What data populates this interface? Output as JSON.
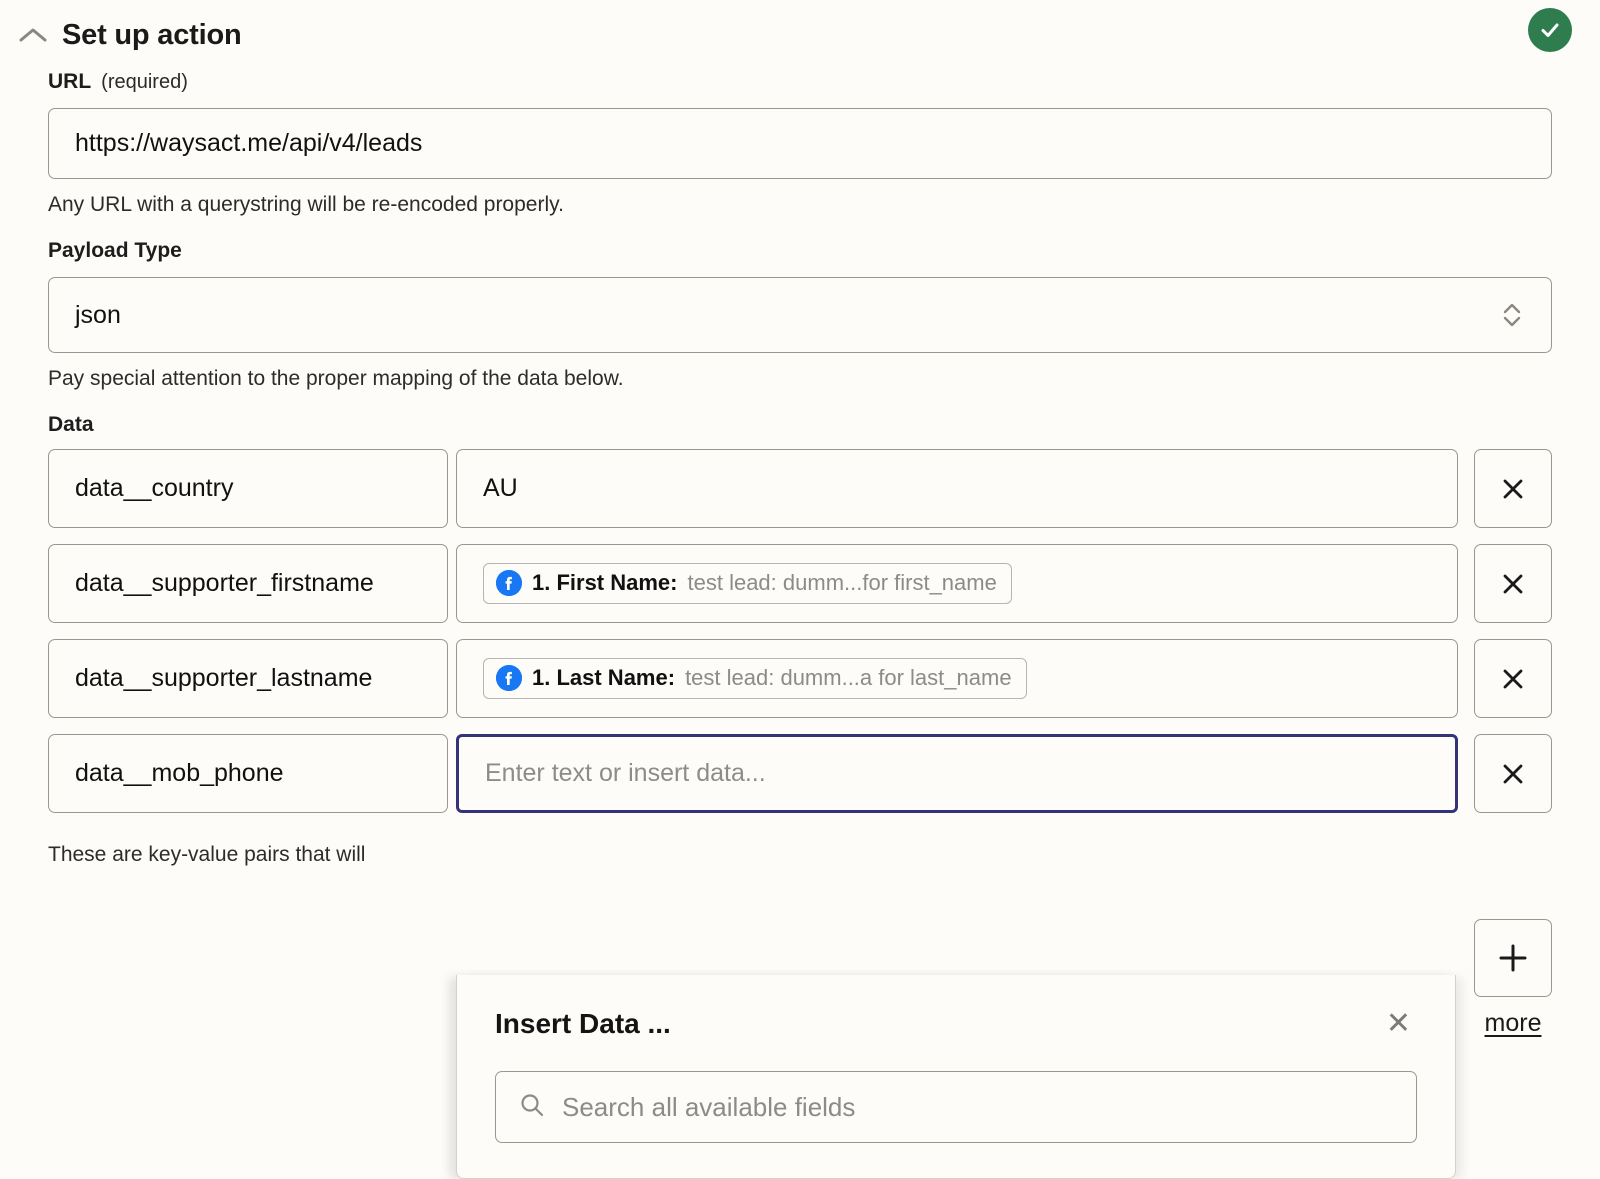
{
  "header": {
    "title": "Set up action",
    "collapse_icon": "chevron-up-icon",
    "status_icon": "check-circle-icon",
    "status_color": "#2f7d4f"
  },
  "url_field": {
    "label": "URL",
    "required_note": "(required)",
    "value": "https://waysact.me/api/v4/leads",
    "help": "Any URL with a querystring will be re-encoded properly."
  },
  "payload_type_field": {
    "label": "Payload Type",
    "value": "json",
    "help": "Pay special attention to the proper mapping of the data below.",
    "caret_icon": "chevron-up-down-icon"
  },
  "data_section": {
    "label": "Data",
    "footer_note": "These are key-value pairs that will",
    "remove_icon": "close-x-icon",
    "add_icon": "plus-icon",
    "more_label": "more",
    "rows": [
      {
        "key": "data__country",
        "value_kind": "text",
        "value": "AU",
        "remove_label": "×"
      },
      {
        "key": "data__supporter_firstname",
        "value_kind": "token",
        "token_source_icon": "facebook-icon",
        "token_label": "1. First Name:",
        "token_sample": "test lead: dumm...for first_name",
        "remove_label": "×"
      },
      {
        "key": "data__supporter_lastname",
        "value_kind": "token",
        "token_source_icon": "facebook-icon",
        "token_label": "1. Last Name:",
        "token_sample": "test lead: dumm...a for last_name",
        "remove_label": "×"
      },
      {
        "key": "data__mob_phone",
        "value_kind": "empty",
        "placeholder": "Enter text or insert data...",
        "focused": true,
        "remove_label": "×"
      }
    ]
  },
  "insert_data_panel": {
    "title": "Insert Data ...",
    "close_label": "✕",
    "close_icon": "close-x-icon",
    "search_icon": "search-icon",
    "search_placeholder": "Search all available fields"
  },
  "colors": {
    "page_background": "#fdfcf8",
    "focus_border": "#33337a",
    "facebook_blue": "#1877f2",
    "success_green": "#2f7d4f"
  }
}
